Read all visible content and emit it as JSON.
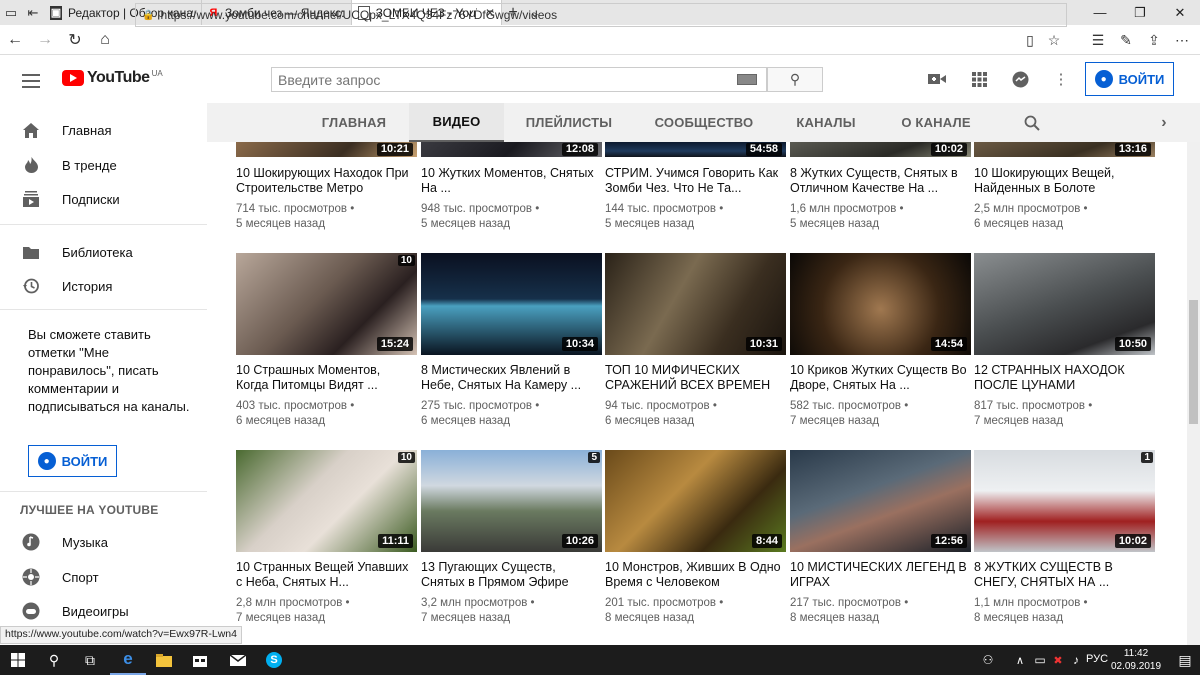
{
  "browser": {
    "tabs": [
      {
        "title": "Редактор | Обзор канала 3",
        "favicon": "edit-icon"
      },
      {
        "title": "Зомби чез — Яндекс: нашл",
        "favicon": "yandex-icon"
      },
      {
        "title": "ЗОМБИ ЧЕЗ - YouTube",
        "favicon": "page-icon",
        "active": true
      }
    ],
    "url": "https://www.youtube.com/channel/UCQpx_LTX4Q34Fz76YDfGwgw/videos"
  },
  "masthead": {
    "logo_text": "YouTube",
    "region": "UA",
    "search_placeholder": "Введите запрос",
    "signin_label": "ВОЙТИ"
  },
  "sidebar": {
    "items": [
      {
        "label": "Главная",
        "icon": "home-icon"
      },
      {
        "label": "В тренде",
        "icon": "trending-icon"
      },
      {
        "label": "Подписки",
        "icon": "subscriptions-icon"
      },
      {
        "label": "Библиотека",
        "icon": "library-icon"
      },
      {
        "label": "История",
        "icon": "history-icon"
      }
    ],
    "promo_text": "Вы сможете ставить отметки \"Мне понравилось\", писать комментарии и подписываться на каналы.",
    "signin_label": "ВОЙТИ",
    "best_header": "ЛУЧШЕЕ НА YOUTUBE",
    "best_items": [
      {
        "label": "Музыка",
        "icon": "music-icon"
      },
      {
        "label": "Спорт",
        "icon": "sport-icon"
      },
      {
        "label": "Видеоигры",
        "icon": "gaming-icon"
      }
    ]
  },
  "channel_tabs": [
    "ГЛАВНАЯ",
    "ВИДЕО",
    "ПЛЕЙЛИСТЫ",
    "СООБЩЕСТВО",
    "КАНАЛЫ",
    "О КАНАЛЕ"
  ],
  "selected_tab": "ВИДЕО",
  "videos": [
    {
      "title": "10 Шокирующих Находок При Строительстве Метро",
      "views": "714 тыс. просмотров",
      "age": "5 месяцев назад",
      "duration": "10:21"
    },
    {
      "title": "10 Жутких Моментов, Снятых На ...",
      "views": "948 тыс. просмотров",
      "age": "5 месяцев назад",
      "duration": "12:08"
    },
    {
      "title": "СТРИМ. Учимся Говорить Как Зомби Чез. Что Не Та...",
      "views": "144 тыс. просмотров",
      "age": "5 месяцев назад",
      "duration": "54:58"
    },
    {
      "title": "8 Жутких Существ, Снятых в Отличном Качестве На ...",
      "views": "1,6 млн просмотров",
      "age": "5 месяцев назад",
      "duration": "10:02"
    },
    {
      "title": "10 Шокирующих Вещей, Найденных в Болоте",
      "views": "2,5 млн просмотров",
      "age": "6 месяцев назад",
      "duration": "13:16"
    },
    {
      "title": "10 Страшных Моментов, Когда Питомцы Видят ...",
      "views": "403 тыс. просмотров",
      "age": "6 месяцев назад",
      "duration": "15:24",
      "badge": "10"
    },
    {
      "title": "8 Мистических Явлений в Небе, Снятых На Камеру ...",
      "views": "275 тыс. просмотров",
      "age": "6 месяцев назад",
      "duration": "10:34"
    },
    {
      "title": "ТОП 10 МИФИЧЕСКИХ СРАЖЕНИЙ ВСЕХ ВРЕМЕН",
      "views": "94 тыс. просмотров",
      "age": "6 месяцев назад",
      "duration": "10:31"
    },
    {
      "title": "10 Криков Жутких Существ Во Дворе, Снятых На ...",
      "views": "582 тыс. просмотров",
      "age": "7 месяцев назад",
      "duration": "14:54"
    },
    {
      "title": "12 СТРАННЫХ НАХОДОК ПОСЛЕ ЦУНАМИ",
      "views": "817 тыс. просмотров",
      "age": "7 месяцев назад",
      "duration": "10:50"
    },
    {
      "title": "10 Странных Вещей Упавших с Неба, Снятых Н...",
      "views": "2,8 млн просмотров",
      "age": "7 месяцев назад",
      "duration": "11:11",
      "badge": "10"
    },
    {
      "title": "13 Пугающих Существ, Снятых в Прямом Эфире",
      "views": "3,2 млн просмотров",
      "age": "7 месяцев назад",
      "duration": "10:26",
      "badge": "5"
    },
    {
      "title": "10 Монстров, Живших В Одно Время с Человеком",
      "views": "201 тыс. просмотров",
      "age": "8 месяцев назад",
      "duration": "8:44"
    },
    {
      "title": "10 МИСТИЧЕСКИХ ЛЕГЕНД В ИГРАХ",
      "views": "217 тыс. просмотров",
      "age": "8 месяцев назад",
      "duration": "12:56"
    },
    {
      "title": "8 ЖУТКИХ СУЩЕСТВ В СНЕГУ, СНЯТЫХ НА ...",
      "views": "1,1 млн просмотров",
      "age": "8 месяцев назад",
      "duration": "10:02",
      "badge": "1"
    }
  ],
  "status_url": "https://www.youtube.com/watch?v=Ewx97R-Lwn4",
  "taskbar": {
    "lang": "РУС",
    "time": "11:42",
    "date": "02.09.2019"
  }
}
